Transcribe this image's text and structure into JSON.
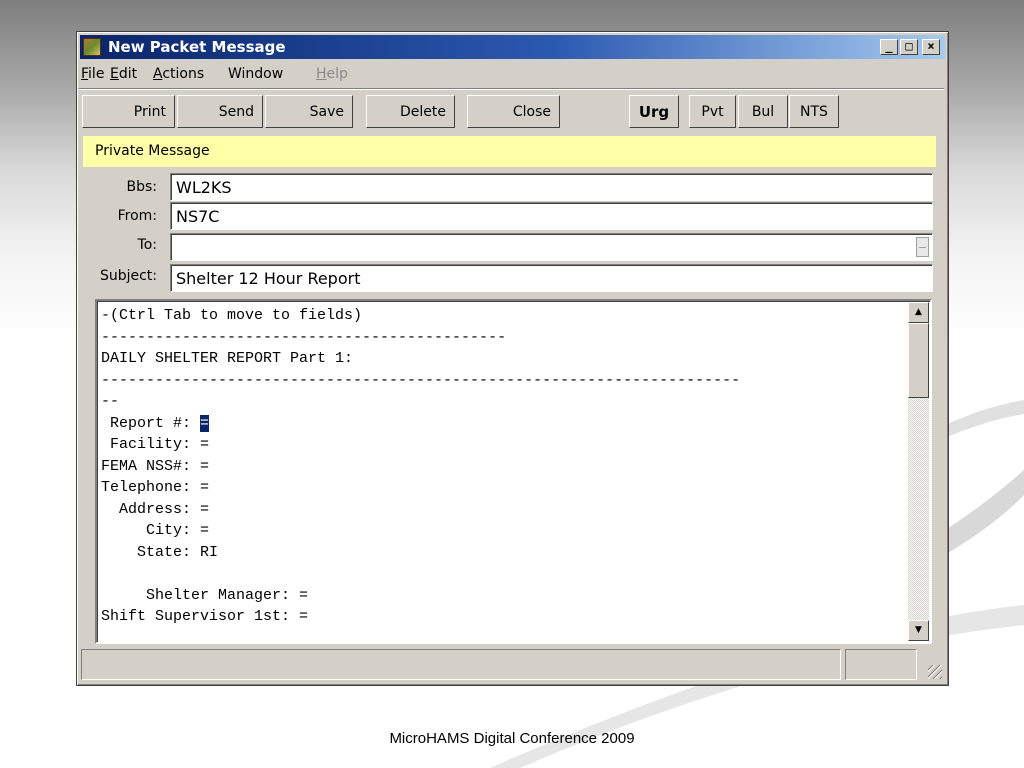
{
  "window": {
    "title": "New Packet Message"
  },
  "menu": {
    "items": [
      {
        "label": "File",
        "accel": "F",
        "rest": "ile",
        "disabled": false
      },
      {
        "label": "Edit",
        "accel": "E",
        "rest": "dit",
        "disabled": false
      },
      {
        "label": "Actions",
        "accel": "A",
        "rest": "ctions",
        "disabled": false
      },
      {
        "label": "Window",
        "accel": "",
        "rest": "Window",
        "disabled": false
      },
      {
        "label": "Help",
        "accel": "H",
        "rest": "elp",
        "disabled": true
      }
    ]
  },
  "toolbar": {
    "print": "Print",
    "send": "Send",
    "save": "Save",
    "delete": "Delete",
    "close": "Close",
    "urg": "Urg",
    "pvt": "Pvt",
    "bul": "Bul",
    "nts": "NTS"
  },
  "message_type": "Private Message",
  "fields": {
    "bbs": {
      "label": "Bbs:",
      "value": "WL2KS"
    },
    "from": {
      "label": "From:",
      "value": "NS7C"
    },
    "to": {
      "label": "To:",
      "value": ""
    },
    "subject": {
      "label": "Subject:",
      "value": "Shelter 12 Hour Report"
    }
  },
  "body": {
    "lines": [
      "-(Ctrl Tab to move to fields)",
      "---------------------------------------------",
      "DAILY SHELTER REPORT Part 1:",
      "-----------------------------------------------------------------------",
      "--",
      " Report #: ",
      " Facility: =",
      "FEMA NSS#: =",
      "Telephone: =",
      "  Address: =",
      "     City: =",
      "    State: RI",
      "",
      "     Shelter Manager: =",
      "Shift Supervisor 1st: ="
    ],
    "caret_char": "="
  },
  "scrollbar": {
    "position": 0.0
  },
  "footer": "MicroHAMS Digital Conference 2009",
  "colors": {
    "title_start": "#0a246a",
    "title_end": "#a6caf0",
    "private_bar": "#ffffa8",
    "window_face": "#d4d0c8"
  }
}
